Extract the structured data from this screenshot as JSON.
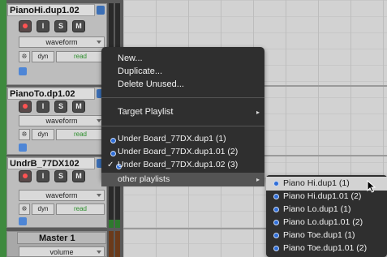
{
  "tracks": [
    {
      "name": "PianoHi.dup1.02",
      "view": "waveform",
      "dyn": "dyn",
      "mode": "read"
    },
    {
      "name": "PianoTo.dp1.02",
      "view": "waveform",
      "dyn": "dyn",
      "mode": "read"
    },
    {
      "name": "UndrB_77DX102",
      "view": "waveform",
      "dyn": "dyn",
      "mode": "read"
    },
    {
      "name": "Master 1",
      "view": "volume"
    }
  ],
  "track_buttons": {
    "input": "I",
    "solo": "S",
    "mute": "M"
  },
  "menu": {
    "new": "New...",
    "duplicate": "Duplicate...",
    "delete_unused": "Delete Unused...",
    "target_playlist": "Target Playlist",
    "playlists": [
      "Under Board_77DX.dup1 (1)",
      "Under Board_77DX.dup1.01 (2)",
      "Under Board_77DX.dup1.02 (3)"
    ],
    "other_playlists": "other playlists",
    "submenu_arrow": "▸",
    "check": "✓"
  },
  "submenu": {
    "items": [
      "Piano Hi.dup1 (1)",
      "Piano Hi.dup1.01 (2)",
      "Piano Lo.dup1 (1)",
      "Piano Lo.dup1.01 (2)",
      "Piano Toe.dup1 (1)",
      "Piano Toe.dup1.01 (2)"
    ]
  },
  "colors": {
    "playlist_bullet": "#2f6ed8",
    "track_color_strip": "#3e8a3e",
    "mode_read": "#2c8f2c"
  }
}
